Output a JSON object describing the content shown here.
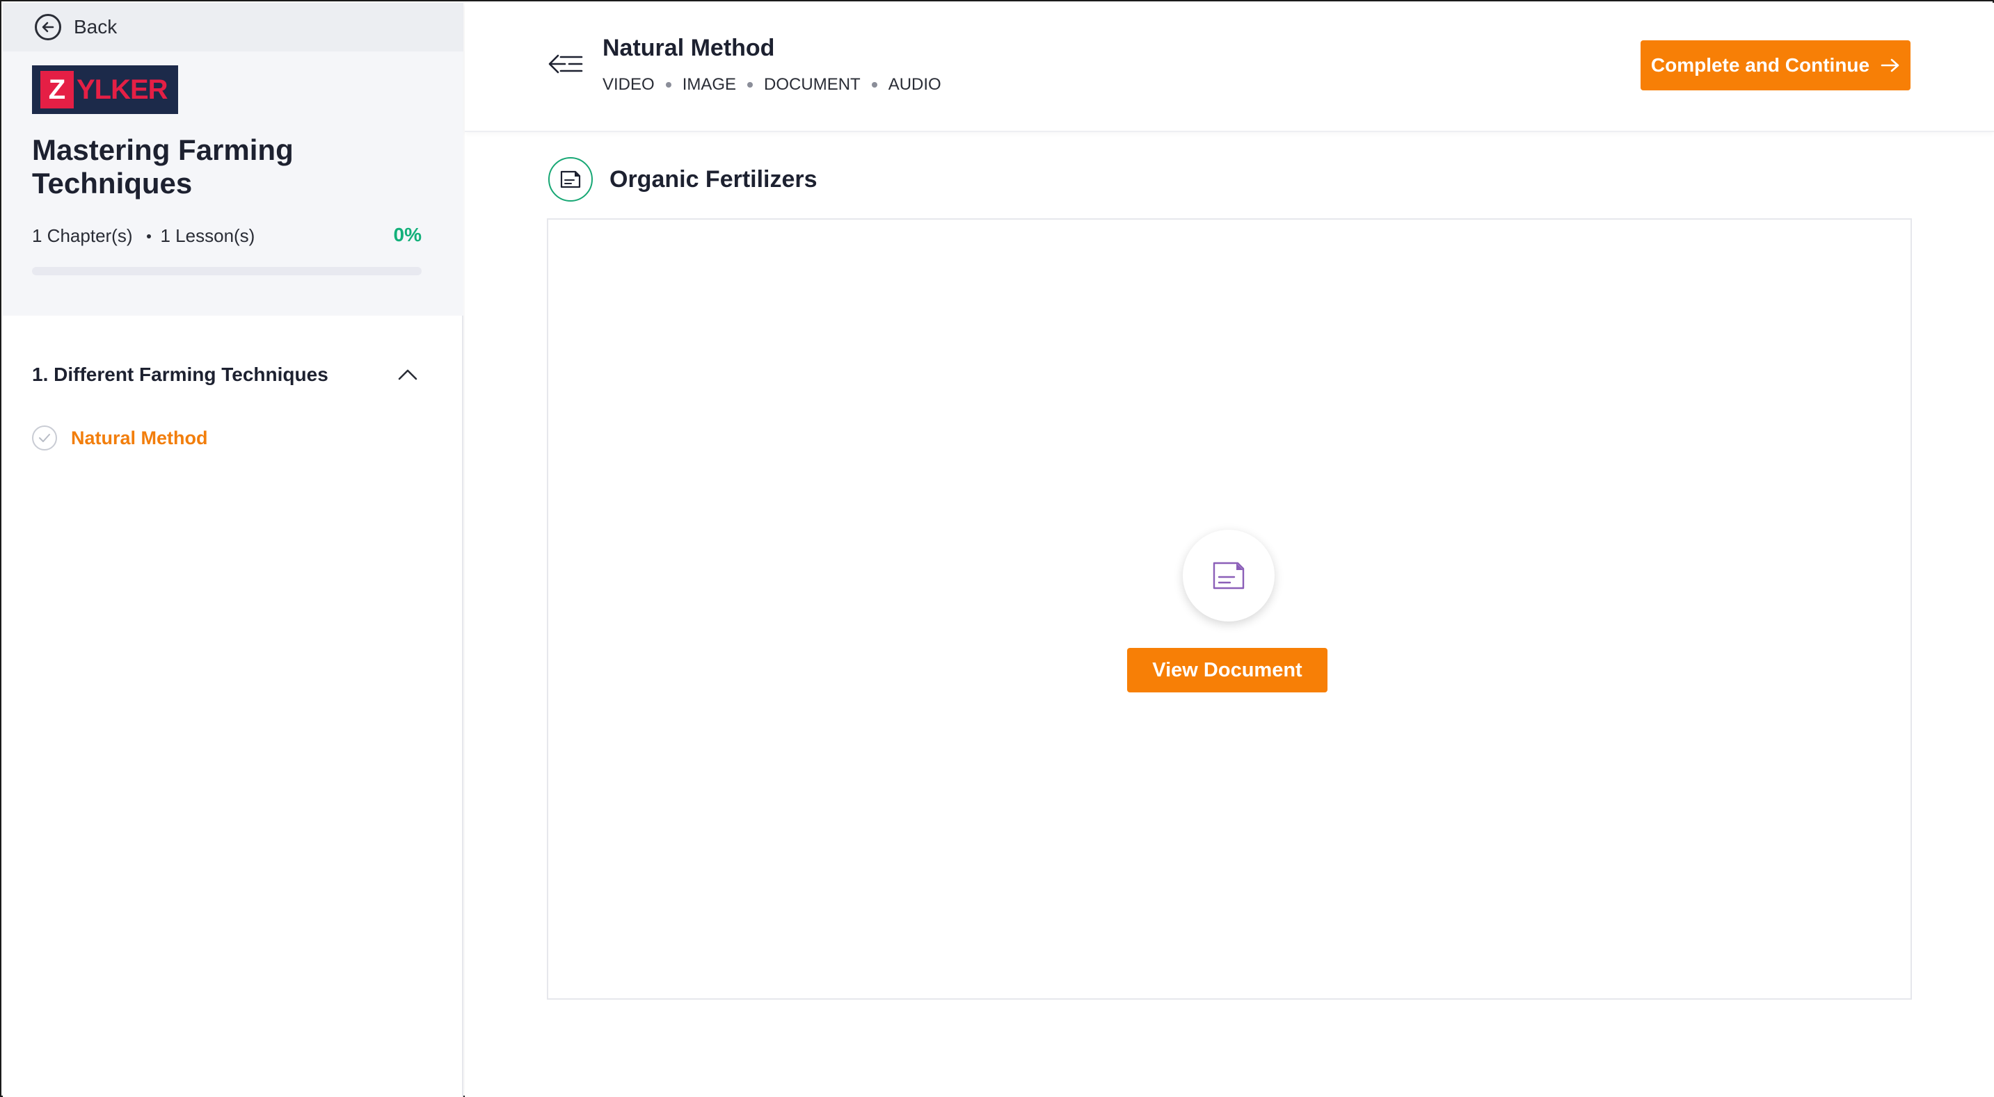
{
  "sidebar": {
    "back_label": "Back",
    "logo": {
      "initial": "Z",
      "rest": "YLKER"
    },
    "course_title": "Mastering Farming Techniques",
    "chapters_count": "1 Chapter(s)",
    "lessons_count": "1 Lesson(s)",
    "progress_label": "0%",
    "progress_value": 0,
    "chapter": {
      "title": "1.  Different Farming Techniques",
      "expanded": true
    },
    "lesson": {
      "label": "Natural Method",
      "completed": false
    }
  },
  "header": {
    "lesson_title": "Natural Method",
    "types": [
      "VIDEO",
      "IMAGE",
      "DOCUMENT",
      "AUDIO"
    ],
    "cta_label": "Complete and Continue"
  },
  "content": {
    "section_title": "Organic Fertilizers",
    "view_button_label": "View Document"
  },
  "colors": {
    "accent_orange": "#f77f06",
    "success_green": "#13b07a",
    "doc_purple": "#8b5fb8",
    "logo_red": "#e51f45",
    "logo_navy": "#1c2a4a"
  },
  "icons": [
    "back-arrow-icon",
    "chevron-up-icon",
    "check-circle-icon",
    "sidebar-collapse-icon",
    "arrow-right-icon",
    "document-icon"
  ]
}
